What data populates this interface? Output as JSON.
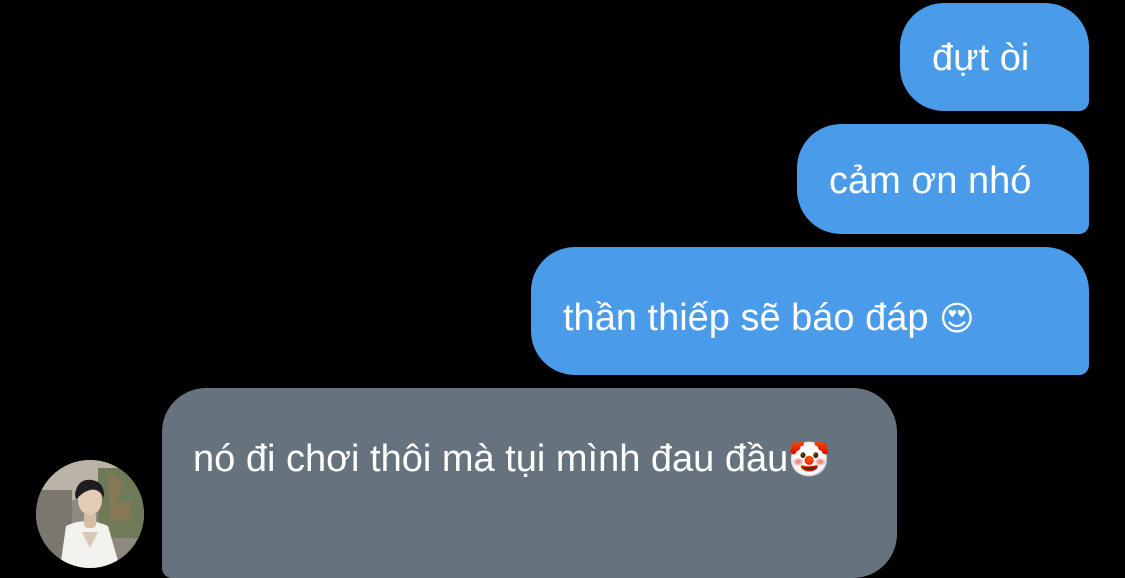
{
  "messages": [
    {
      "direction": "outgoing",
      "text": "đựt òi"
    },
    {
      "direction": "outgoing",
      "text": "cảm ơn nhó"
    },
    {
      "direction": "outgoing",
      "text": "thần thiếp sẽ báo đáp",
      "emoji": "😍",
      "emoji_name": "heart-eyes-emoji"
    },
    {
      "direction": "incoming",
      "text": "nó đi chơi thôi mà tụi mình đau đầu",
      "emoji": "🤡",
      "emoji_name": "clown-emoji"
    }
  ],
  "colors": {
    "background": "#000000",
    "outgoing_bubble": "#4a9bea",
    "incoming_bubble": "#66737f",
    "text": "#ffffff"
  },
  "sender": {
    "avatar": "profile-photo"
  }
}
